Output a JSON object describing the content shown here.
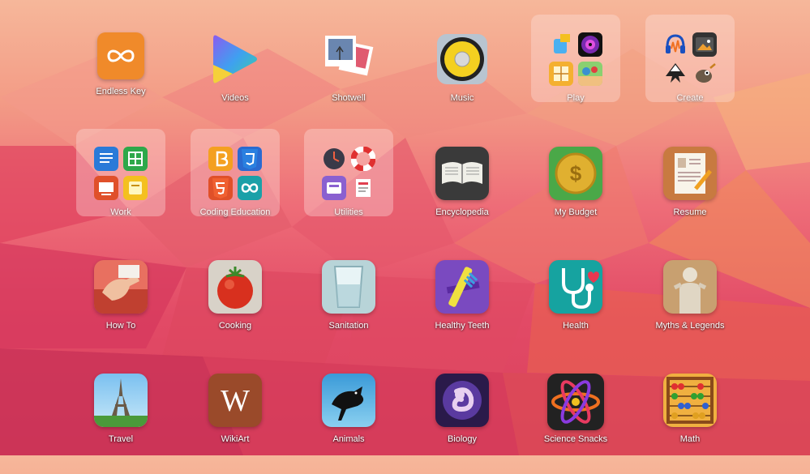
{
  "desktop": {
    "apps": [
      {
        "label": "Endless Key",
        "icon": "infinity-icon"
      },
      {
        "label": "Videos",
        "icon": "play-icon"
      },
      {
        "label": "Shotwell",
        "icon": "photos-icon"
      },
      {
        "label": "Music",
        "icon": "speaker-icon"
      },
      {
        "label": "Play",
        "icon": "folder-icon"
      },
      {
        "label": "Create",
        "icon": "folder-icon"
      },
      {
        "label": "Work",
        "icon": "folder-icon"
      },
      {
        "label": "Coding Education",
        "icon": "folder-icon"
      },
      {
        "label": "Utilities",
        "icon": "folder-icon"
      },
      {
        "label": "Encyclopedia",
        "icon": "book-icon"
      },
      {
        "label": "My Budget",
        "icon": "dollar-coin-icon"
      },
      {
        "label": "Resume",
        "icon": "resume-icon"
      },
      {
        "label": "How To",
        "icon": "hand-icon"
      },
      {
        "label": "Cooking",
        "icon": "tomato-icon"
      },
      {
        "label": "Sanitation",
        "icon": "glass-icon"
      },
      {
        "label": "Healthy Teeth",
        "icon": "toothbrush-icon"
      },
      {
        "label": "Health",
        "icon": "stethoscope-icon"
      },
      {
        "label": "Myths & Legends",
        "icon": "statue-icon"
      },
      {
        "label": "Travel",
        "icon": "eiffel-tower-icon"
      },
      {
        "label": "WikiArt",
        "icon": "wikiart-icon"
      },
      {
        "label": "Animals",
        "icon": "bird-icon"
      },
      {
        "label": "Biology",
        "icon": "embryo-icon"
      },
      {
        "label": "Science Snacks",
        "icon": "atom-icon"
      },
      {
        "label": "Math",
        "icon": "abacus-icon"
      }
    ],
    "colors": {
      "accent_orange": "#f28a2e",
      "background_top": "#f6b79a",
      "background_bottom": "#d9405c"
    }
  }
}
